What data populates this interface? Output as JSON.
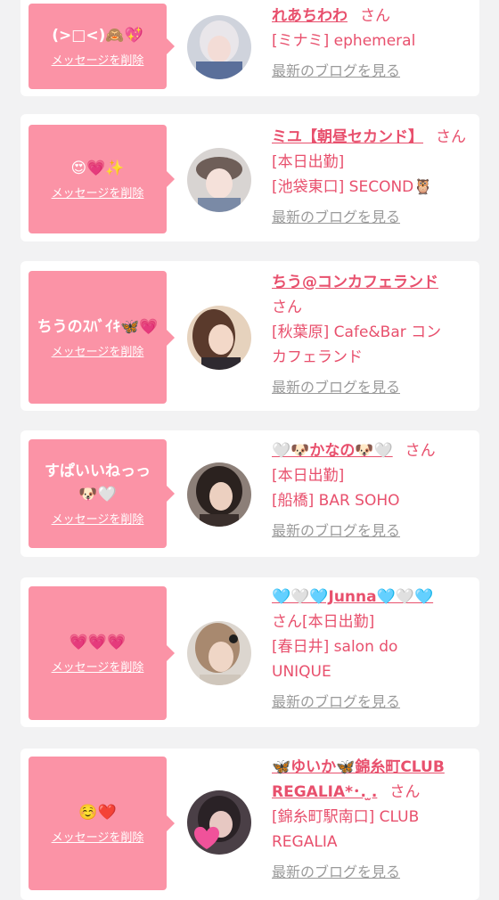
{
  "common": {
    "delete_label": "メッセージを削除",
    "blog_label": "最新のブログを見る",
    "san": "さん"
  },
  "colors": {
    "page_bg": "#f2f2f3",
    "card_bg": "#ffffff",
    "bubble": "#fb93a6",
    "accent": "#e8506d",
    "link_gray": "#9a9a9a"
  },
  "messages": [
    {
      "message": "(>□<)🙈💖",
      "name": "れあちわわ",
      "lines": [
        "[ミナミ] ephemeral"
      ]
    },
    {
      "message": "😍💗✨",
      "name": "ミユ【朝昼セカンド】",
      "lines": [
        "[本日出勤]",
        "[池袋東口] SECOND🦉"
      ]
    },
    {
      "message": "ちうのｽﾊﾞｲｷ🦋💗",
      "name": "ちう@コンカフェランド",
      "lines": [
        "[秋葉原] Cafe&Bar コン",
        "カフェランド"
      ]
    },
    {
      "message": "すぱいいねっっ🐶🤍",
      "name": "🤍🐶かなの🐶🤍",
      "lines": [
        "[本日出勤]",
        "[船橋] BAR SOHO"
      ]
    },
    {
      "message": "💗💗💗",
      "name": "🩵🤍🩵Junna🩵🤍🩵",
      "lines": [
        "[本日出勤]",
        "[春日井] salon do",
        "UNIQUE"
      ]
    },
    {
      "message": "☺️❤️",
      "name": "🦋ゆいか🦋錦糸町CLUB REGALIA*･. ̫.",
      "lines": [
        "[錦糸町駅南口] CLUB",
        "REGALIA"
      ]
    }
  ]
}
